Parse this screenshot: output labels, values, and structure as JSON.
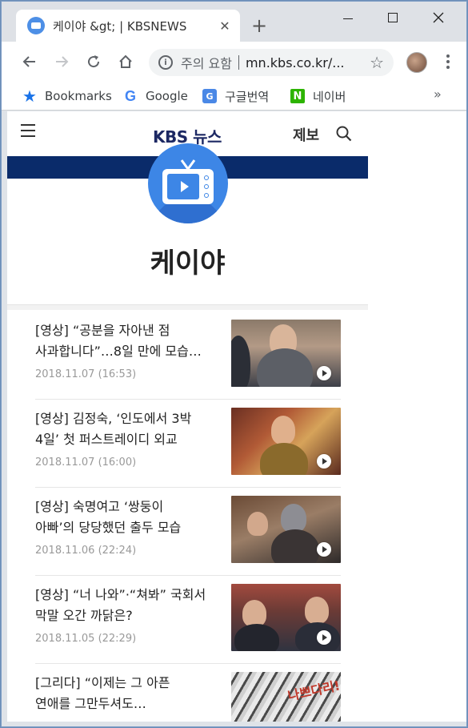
{
  "browser": {
    "tab_title": "케이야 &gt; | KBSNEWS",
    "tab_close": "✕",
    "new_tab": "+",
    "omnibox": {
      "security_label": "주의 요함",
      "url": "mn.kbs.co.kr/..."
    },
    "bookmarks": [
      {
        "label": "Bookmarks",
        "icon": "star-icon"
      },
      {
        "label": "Google",
        "icon": "google-icon"
      },
      {
        "label": "구글번역",
        "icon": "translate-icon"
      },
      {
        "label": "네이버",
        "icon": "naver-icon"
      }
    ],
    "bookmarks_more": "»"
  },
  "site": {
    "logo_kbs": "KBS",
    "logo_news": "뉴스",
    "tip_label": "제보",
    "program_title": "케이야"
  },
  "articles": [
    {
      "title_line1": "[영상] “공분을 자아낸 점",
      "title_line2": "사과합니다”…8일 만에 모습…",
      "date": "2018.11.07 (16:53)"
    },
    {
      "title_line1": "[영상] 김정숙, ‘인도에서 3박",
      "title_line2": "4일’ 첫 퍼스트레이디 외교",
      "date": "2018.11.07 (16:00)"
    },
    {
      "title_line1": "[영상] 숙명여고 ‘쌍둥이",
      "title_line2": "아빠’의 당당했던 출두 모습",
      "date": "2018.11.06 (22:24)"
    },
    {
      "title_line1": "[영상] “너 나와”·“쳐봐” 국회서",
      "title_line2": "막말 오간 까닭은?",
      "date": "2018.11.05 (22:29)"
    },
    {
      "title_line1": "[그리다] “이제는 그 아픈",
      "title_line2": "연애를 그만두셔도…",
      "date": "",
      "thumb_caption": "나쁘다리!"
    }
  ],
  "colors": {
    "navy": "#0a2b6a",
    "brand_blue": "#3d86e6",
    "date_gray": "#999999",
    "naver_green": "#2db400"
  }
}
